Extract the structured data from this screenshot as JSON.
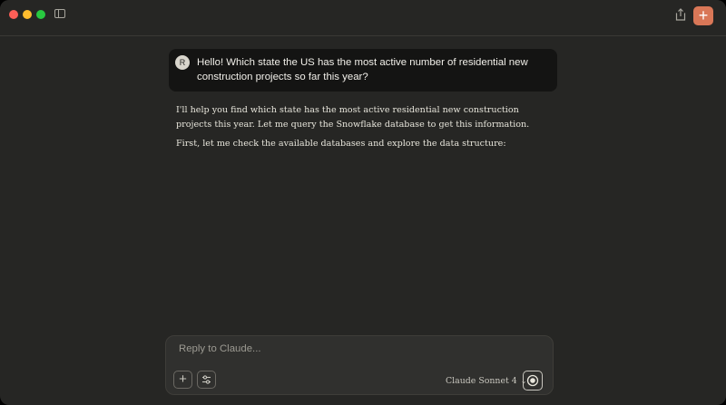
{
  "titlebar": {
    "icons": [
      "close-icon",
      "minimize-icon",
      "maximize-icon",
      "sidebar-toggle-icon",
      "share-icon",
      "plus-icon"
    ],
    "new_chat_label": "+"
  },
  "conversation": {
    "user_avatar": "R",
    "user_message": "Hello! Which state the US has the most active number of residential new construction projects so far this year?",
    "assistant_paragraphs": [
      "I'll help you find which state has the most active residential new construction projects this year. Let me query the Snowflake database to get this information.",
      "First, let me check the available databases and explore the data structure:"
    ]
  },
  "composer": {
    "placeholder": "Reply to Claude...",
    "attach_label": "+",
    "model": "Claude Sonnet 4"
  },
  "colors": {
    "accent": "#d97757",
    "background": "#262624",
    "user_bubble": "#141413"
  }
}
